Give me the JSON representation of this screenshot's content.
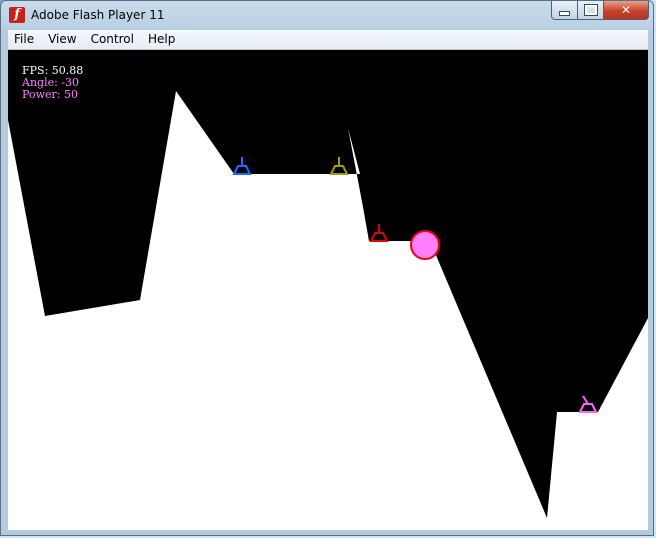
{
  "window": {
    "title": "Adobe Flash Player 11",
    "app_icon_glyph": "f",
    "close_glyph": "✕"
  },
  "menu": {
    "items": [
      {
        "label": "File"
      },
      {
        "label": "View"
      },
      {
        "label": "Control"
      },
      {
        "label": "Help"
      }
    ]
  },
  "game": {
    "hud": {
      "fps_text": "FPS: 50.88",
      "angle_text": "Angle: -30",
      "power_text": "Power: 50",
      "fps_color": "#ffffff",
      "angle_color": "#ff80ff",
      "power_color": "#ff80ff"
    },
    "colors": {
      "sky": "#000000",
      "terrain": "#ffffff",
      "projectile_fill": "#ff80ff",
      "projectile_stroke": "#ee0000"
    },
    "tanks": [
      {
        "name": "blue-tank",
        "color": "#1a6cff"
      },
      {
        "name": "olive-tank",
        "color": "#a09a10"
      },
      {
        "name": "red-tank",
        "color": "#e00000"
      },
      {
        "name": "pink-tank",
        "color": "#ff66ff"
      }
    ]
  }
}
